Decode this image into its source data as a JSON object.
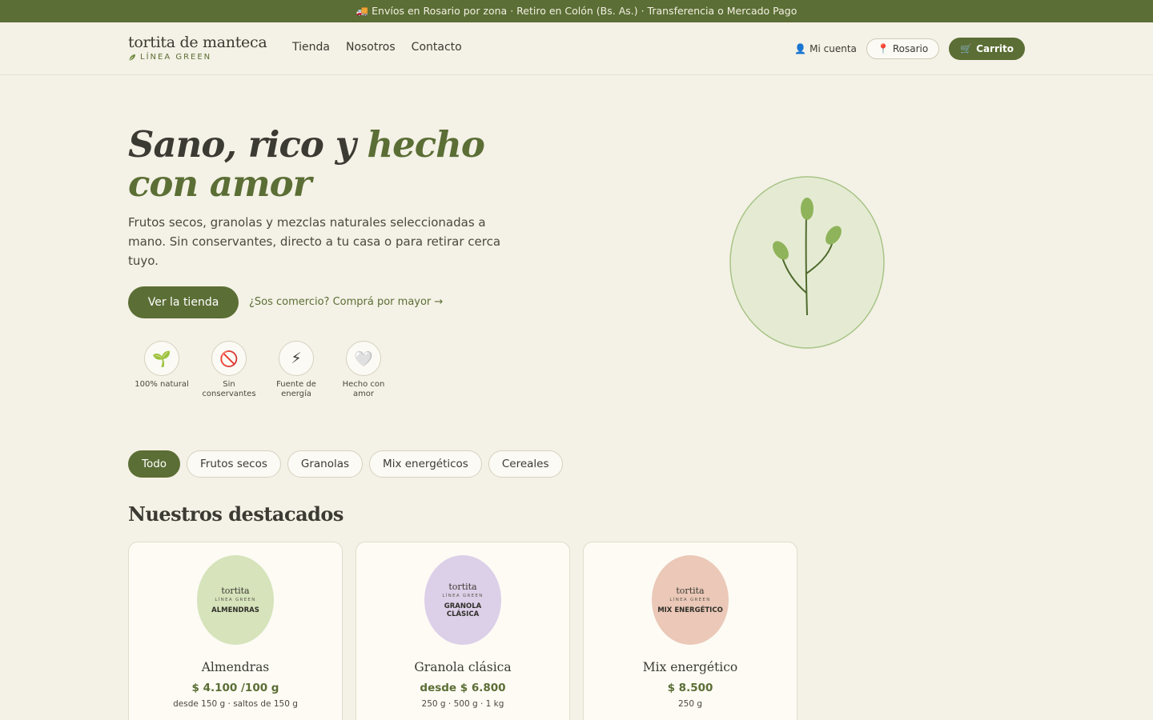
{
  "announcement": {
    "icon": "truck-icon",
    "text": "🚚 Envíos en Rosario por zona · Retiro en Colón (Bs. As.) · Transferencia o Mercado Pago"
  },
  "brand": {
    "name": "tortita de manteca",
    "line_icon": "leaf-icon",
    "line": "LÍNEA GREEN"
  },
  "nav": {
    "items": [
      "Tienda",
      "Nosotros",
      "Contacto"
    ]
  },
  "header_actions": {
    "account_icon": "👤",
    "account_label": "Mi cuenta",
    "location_icon": "📍",
    "location_label": "Rosario",
    "cart_icon": "🛒",
    "cart_label": "Carrito"
  },
  "hero": {
    "title_part1": "Sano, rico y ",
    "title_accent": "hecho con amor",
    "description": "Frutos secos, granolas y mezclas naturales seleccionadas a mano. Sin conservantes, directo a tu casa o para retirar cerca tuyo.",
    "cta_primary": "Ver la tienda",
    "cta_secondary": "¿Sos comercio? Comprá por mayor →"
  },
  "features": [
    {
      "icon": "🌱",
      "icon_name": "seedling-icon",
      "label": "100% natural"
    },
    {
      "icon": "🚫",
      "icon_name": "no-entry-icon",
      "label": "Sin conservantes"
    },
    {
      "icon": "⚡",
      "icon_name": "lightning-icon",
      "label": "Fuente de energía"
    },
    {
      "icon": "🤍",
      "icon_name": "heart-icon",
      "label": "Hecho con amor"
    }
  ],
  "filters": {
    "active_index": 0,
    "items": [
      "Todo",
      "Frutos secos",
      "Granolas",
      "Mix energéticos",
      "Cereales"
    ]
  },
  "featured": {
    "title": "Nuestros destacados",
    "products": [
      {
        "jar_brand": "tortita",
        "jar_line": "LÍNEA GREEN",
        "jar_label": "ALMENDRAS",
        "jar_color": "#d6e3bb",
        "name": "Almendras",
        "price": "$ 4.100 /100 g",
        "note": "desde 150 g · saltos de 150 g"
      },
      {
        "jar_brand": "tortita",
        "jar_line": "LÍNEA GREEN",
        "jar_label": "GRANOLA CLÁSICA",
        "jar_color": "#dccfe8",
        "name": "Granola clásica",
        "price": "desde $ 6.800",
        "note": "250 g · 500 g · 1 kg"
      },
      {
        "jar_brand": "tortita",
        "jar_line": "LÍNEA GREEN",
        "jar_label": "MIX ENERGÉTICO",
        "jar_color": "#ebc8b8",
        "name": "Mix energético",
        "price": "$ 8.500",
        "note": "250 g"
      }
    ]
  },
  "colors": {
    "brand_green": "#5b6e35",
    "background": "#f4f1e6",
    "art_fill": "#e5ebd3",
    "art_stroke": "#a8c487",
    "leaf": "#8fb35a"
  }
}
